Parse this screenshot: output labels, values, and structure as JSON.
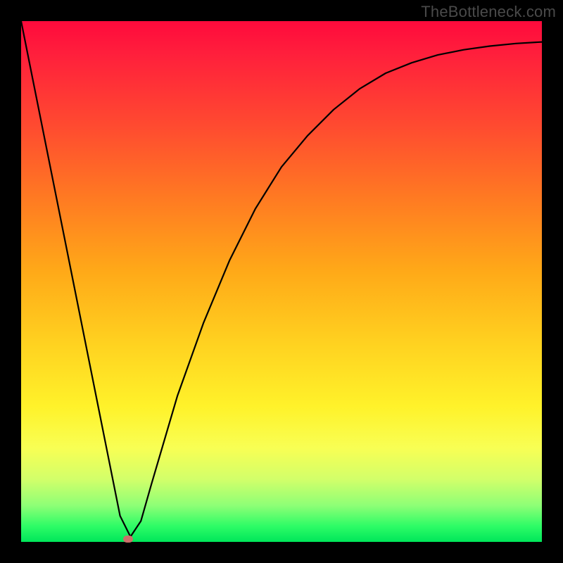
{
  "watermark": "TheBottleneck.com",
  "chart_data": {
    "type": "line",
    "title": "",
    "xlabel": "",
    "ylabel": "",
    "xlim": [
      0,
      1
    ],
    "ylim": [
      0,
      1
    ],
    "series": [
      {
        "name": "curve",
        "x": [
          0.0,
          0.05,
          0.1,
          0.15,
          0.19,
          0.21,
          0.23,
          0.25,
          0.3,
          0.35,
          0.4,
          0.45,
          0.5,
          0.55,
          0.6,
          0.65,
          0.7,
          0.75,
          0.8,
          0.85,
          0.9,
          0.95,
          1.0
        ],
        "y": [
          1.0,
          0.75,
          0.5,
          0.25,
          0.05,
          0.01,
          0.04,
          0.11,
          0.28,
          0.42,
          0.54,
          0.64,
          0.72,
          0.78,
          0.83,
          0.87,
          0.9,
          0.92,
          0.935,
          0.945,
          0.952,
          0.957,
          0.96
        ]
      }
    ],
    "marker": {
      "x": 0.205,
      "y": 0.005
    },
    "background_gradient": {
      "stops": [
        {
          "pos": 0.0,
          "color": "#ff0a3c"
        },
        {
          "pos": 0.2,
          "color": "#ff4a30"
        },
        {
          "pos": 0.48,
          "color": "#ffa918"
        },
        {
          "pos": 0.74,
          "color": "#fff22a"
        },
        {
          "pos": 0.93,
          "color": "#8eff76"
        },
        {
          "pos": 1.0,
          "color": "#00e65a"
        }
      ]
    }
  }
}
